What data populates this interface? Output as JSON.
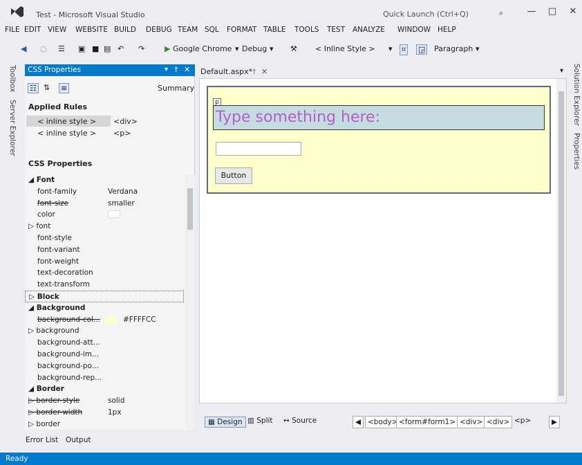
{
  "window": {
    "title": "Test - Microsoft Visual Studio",
    "quick_launch_placeholder": "Quick Launch (Ctrl+Q)",
    "minimize": "—",
    "maximize": "□",
    "close": "✕"
  },
  "menu": [
    "FILE",
    "EDIT",
    "VIEW",
    "WEBSITE",
    "BUILD",
    "DEBUG",
    "TEAM",
    "SQL",
    "FORMAT",
    "TABLE",
    "TOOLS",
    "TEST",
    "ANALYZE",
    "WINDOW",
    "HELP"
  ],
  "toolbar": {
    "browser": "Google Chrome",
    "config": "Debug",
    "style_dropdown": "< Inline Style >",
    "block_dropdown": "Paragraph"
  },
  "left_tabs": [
    "Toolbox",
    "Server Explorer"
  ],
  "right_tabs": [
    "Solution Explorer",
    "Properties"
  ],
  "css_panel": {
    "title": "CSS Properties",
    "summary_label": "Summary",
    "applied_rules_heading": "Applied Rules",
    "applied_rules": [
      {
        "name": "< inline style >",
        "tag": "<div>"
      },
      {
        "name": "< inline style >",
        "tag": "<p>"
      }
    ],
    "css_properties_heading": "CSS Properties",
    "properties": [
      {
        "name": "Font",
        "value": "",
        "kind": "group-open"
      },
      {
        "name": "font-family",
        "value": "Verdana",
        "kind": "prop"
      },
      {
        "name": "font-size",
        "value": "smaller",
        "kind": "struck"
      },
      {
        "name": "color",
        "value": "",
        "kind": "prop"
      },
      {
        "name": "font",
        "value": "",
        "kind": "sub"
      },
      {
        "name": "font-style",
        "value": "",
        "kind": "prop"
      },
      {
        "name": "font-variant",
        "value": "",
        "kind": "prop"
      },
      {
        "name": "font-weight",
        "value": "",
        "kind": "prop"
      },
      {
        "name": "text-decoration",
        "value": "",
        "kind": "prop"
      },
      {
        "name": "text-transform",
        "value": "",
        "kind": "prop"
      },
      {
        "name": "Block",
        "value": "",
        "kind": "group-closed"
      },
      {
        "name": "Background",
        "value": "",
        "kind": "group-open"
      },
      {
        "name": "background-col...",
        "value": "#FFFFCC",
        "kind": "struck-color"
      },
      {
        "name": "background",
        "value": "",
        "kind": "sub"
      },
      {
        "name": "background-att...",
        "value": "",
        "kind": "prop"
      },
      {
        "name": "background-im...",
        "value": "",
        "kind": "prop"
      },
      {
        "name": "background-po...",
        "value": "",
        "kind": "prop"
      },
      {
        "name": "background-rep...",
        "value": "",
        "kind": "prop"
      },
      {
        "name": "Border",
        "value": "",
        "kind": "group-open"
      },
      {
        "name": "border-style",
        "value": "solid",
        "kind": "struck-sub"
      },
      {
        "name": "border-width",
        "value": "1px",
        "kind": "struck-sub"
      },
      {
        "name": "border",
        "value": "",
        "kind": "sub"
      }
    ]
  },
  "document": {
    "tab_name": "Default.aspx*",
    "p_tag": "p",
    "text": "Type something here:",
    "button_label": "Button",
    "form_bg": "#FFFFCC"
  },
  "bottom": {
    "design": "Design",
    "split": "Split",
    "source": "Source",
    "breadcrumbs": [
      "<body>",
      "<form#form1>",
      "<div>",
      "<div>",
      "<p>"
    ]
  },
  "bottom_tabs": {
    "error_list": "Error List",
    "output": "Output"
  },
  "status": "Ready",
  "colors": {
    "accent": "#007acc",
    "text_purple": "#b45fc8"
  }
}
